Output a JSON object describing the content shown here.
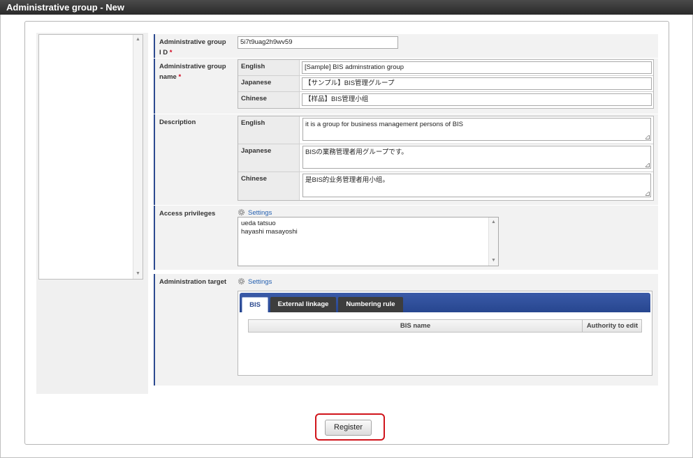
{
  "window": {
    "title": "Administrative group - New"
  },
  "form": {
    "group_id": {
      "label": "Administrative group I D",
      "required_mark": "*",
      "value": "5i7t9uag2h9wv59"
    },
    "group_name": {
      "label": "Administrative group name",
      "required_mark": "*",
      "rows": [
        {
          "lang": "English",
          "value": "[Sample] BIS adminstration group"
        },
        {
          "lang": "Japanese",
          "value": "【サンプル】BIS管理グループ"
        },
        {
          "lang": "Chinese",
          "value": "【样品】BIS管理小组"
        }
      ]
    },
    "description": {
      "label": "Description",
      "rows": [
        {
          "lang": "English",
          "value": "it is a group for business management persons of BIS"
        },
        {
          "lang": "Japanese",
          "value": "BISの業務管理者用グループです。"
        },
        {
          "lang": "Chinese",
          "value": "是BIS的业务管理者用小组。"
        }
      ]
    },
    "access_privileges": {
      "label": "Access privileges",
      "settings_label": "Settings",
      "users": [
        "ueda tatsuo",
        "hayashi masayoshi"
      ]
    },
    "administration_target": {
      "label": "Administration target",
      "settings_label": "Settings",
      "tabs": [
        {
          "label": "BIS",
          "active": true
        },
        {
          "label": "External linkage",
          "active": false
        },
        {
          "label": "Numbering rule",
          "active": false
        }
      ],
      "columns": [
        "BIS name",
        "Authority to edit"
      ]
    }
  },
  "actions": {
    "register_label": "Register"
  },
  "colors": {
    "accent": "#2c4a8f",
    "highlight": "#d0141b",
    "link": "#2560b0"
  }
}
